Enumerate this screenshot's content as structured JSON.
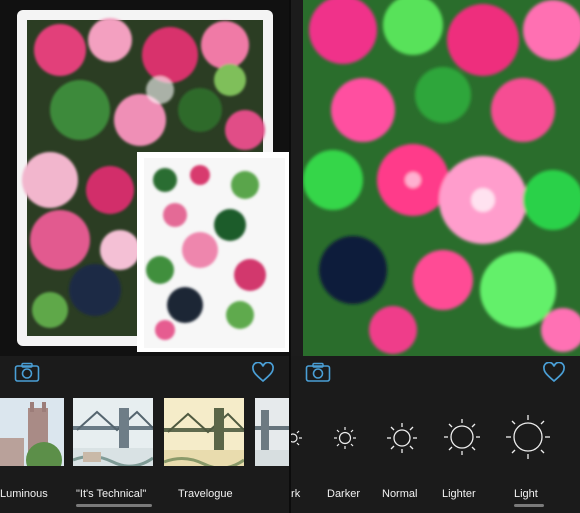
{
  "left_panel": {
    "presets": [
      {
        "label": "Luminous"
      },
      {
        "label": "\"It's Technical\"",
        "selected": true
      },
      {
        "label": "Travelogue"
      },
      {
        "label": ""
      }
    ]
  },
  "right_panel": {
    "brightness_options": [
      {
        "label": "Dark"
      },
      {
        "label": "Darker"
      },
      {
        "label": "Normal"
      },
      {
        "label": "Lighter"
      },
      {
        "label": "Light",
        "selected": true
      }
    ]
  },
  "icons": {
    "camera": "camera-icon",
    "favorite": "heart-icon",
    "brightness": "sun-icon"
  },
  "colors": {
    "accent": "#4a9fd6",
    "background": "#1c1c1c",
    "text": "#f2f2f2"
  }
}
